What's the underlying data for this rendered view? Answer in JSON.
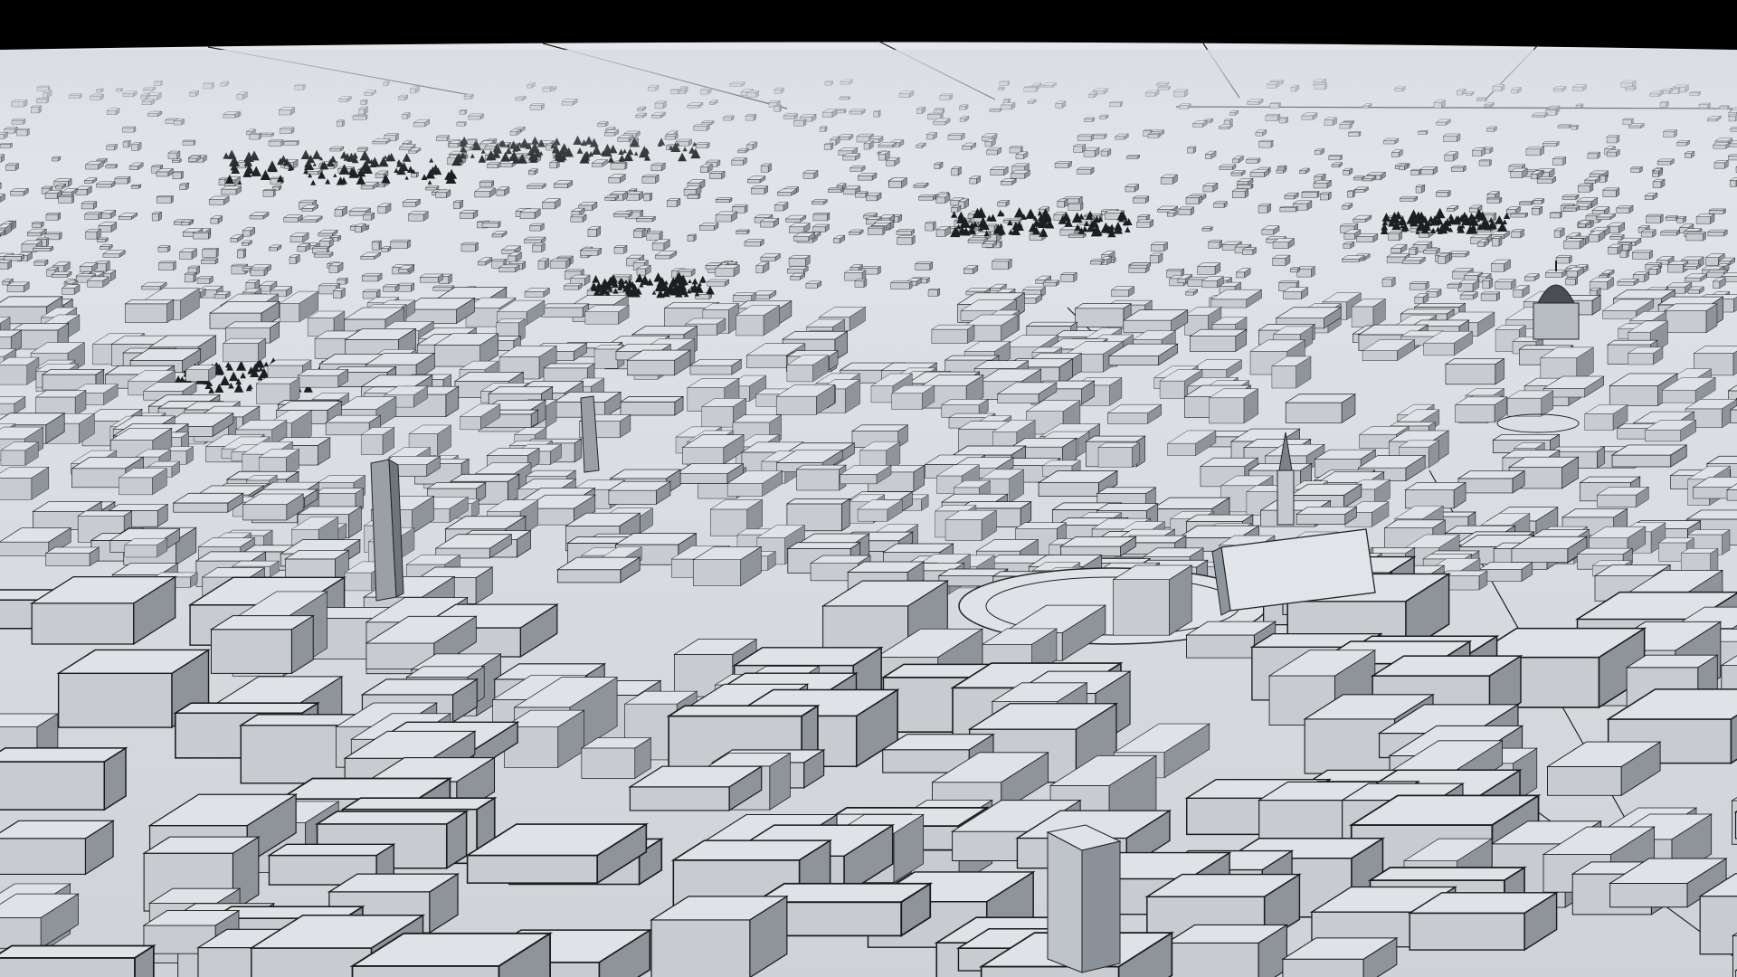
{
  "scene": {
    "kind": "3d-city-model-render",
    "style": "clay-grey-with-black-outlines",
    "colors": {
      "top_bar": "#000000",
      "sky": "#d8dbe0",
      "ground": "#d4d7dc",
      "roof": "#dfe2e6",
      "wall_light": "#c8ccd1",
      "wall_dark": "#8f949b",
      "outline": "#1a1a1a",
      "trees": "#1c1e20"
    }
  }
}
